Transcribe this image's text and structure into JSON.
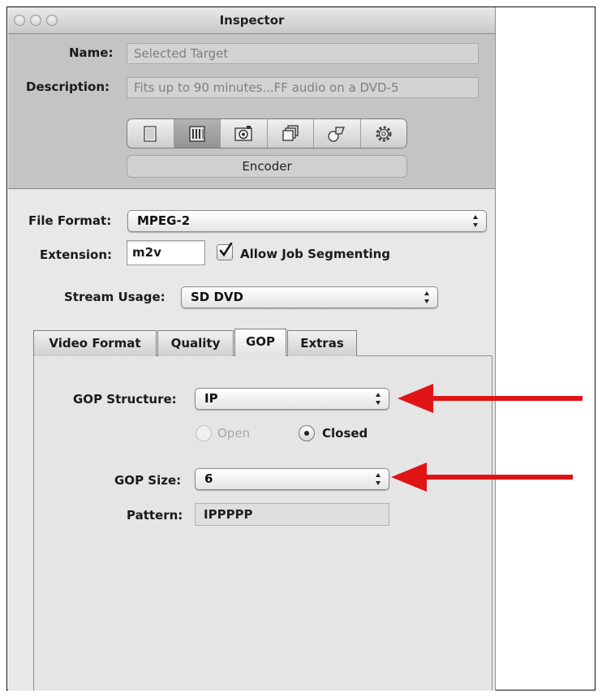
{
  "window": {
    "title": "Inspector"
  },
  "header": {
    "name_label": "Name:",
    "name_value": "Selected Target",
    "description_label": "Description:",
    "description_value": "Fits up to 90 minutes...FF audio on a DVD-5",
    "toolbar_icons": [
      "summary-icon",
      "encoder-icon",
      "frame-controls-icon",
      "filters-icon",
      "geometry-icon",
      "actions-gear-icon"
    ],
    "active_pane": "Encoder"
  },
  "encoder": {
    "file_format_label": "File Format:",
    "file_format_value": "MPEG-2",
    "extension_label": "Extension:",
    "extension_value": "m2v",
    "allow_segmenting_label": "Allow Job Segmenting",
    "allow_segmenting_checked": true,
    "stream_usage_label": "Stream Usage:",
    "stream_usage_value": "SD DVD",
    "tabs": [
      {
        "label": "Video Format",
        "selected": false
      },
      {
        "label": "Quality",
        "selected": false
      },
      {
        "label": "GOP",
        "selected": true
      },
      {
        "label": "Extras",
        "selected": false
      }
    ]
  },
  "gop": {
    "structure_label": "GOP Structure:",
    "structure_value": "IP",
    "open_label": "Open",
    "closed_label": "Closed",
    "selected_option": "Closed",
    "size_label": "GOP Size:",
    "size_value": "6",
    "pattern_label": "Pattern:",
    "pattern_value": "IPPPPP"
  },
  "annotations": {
    "arrow_color": "#e01414"
  }
}
